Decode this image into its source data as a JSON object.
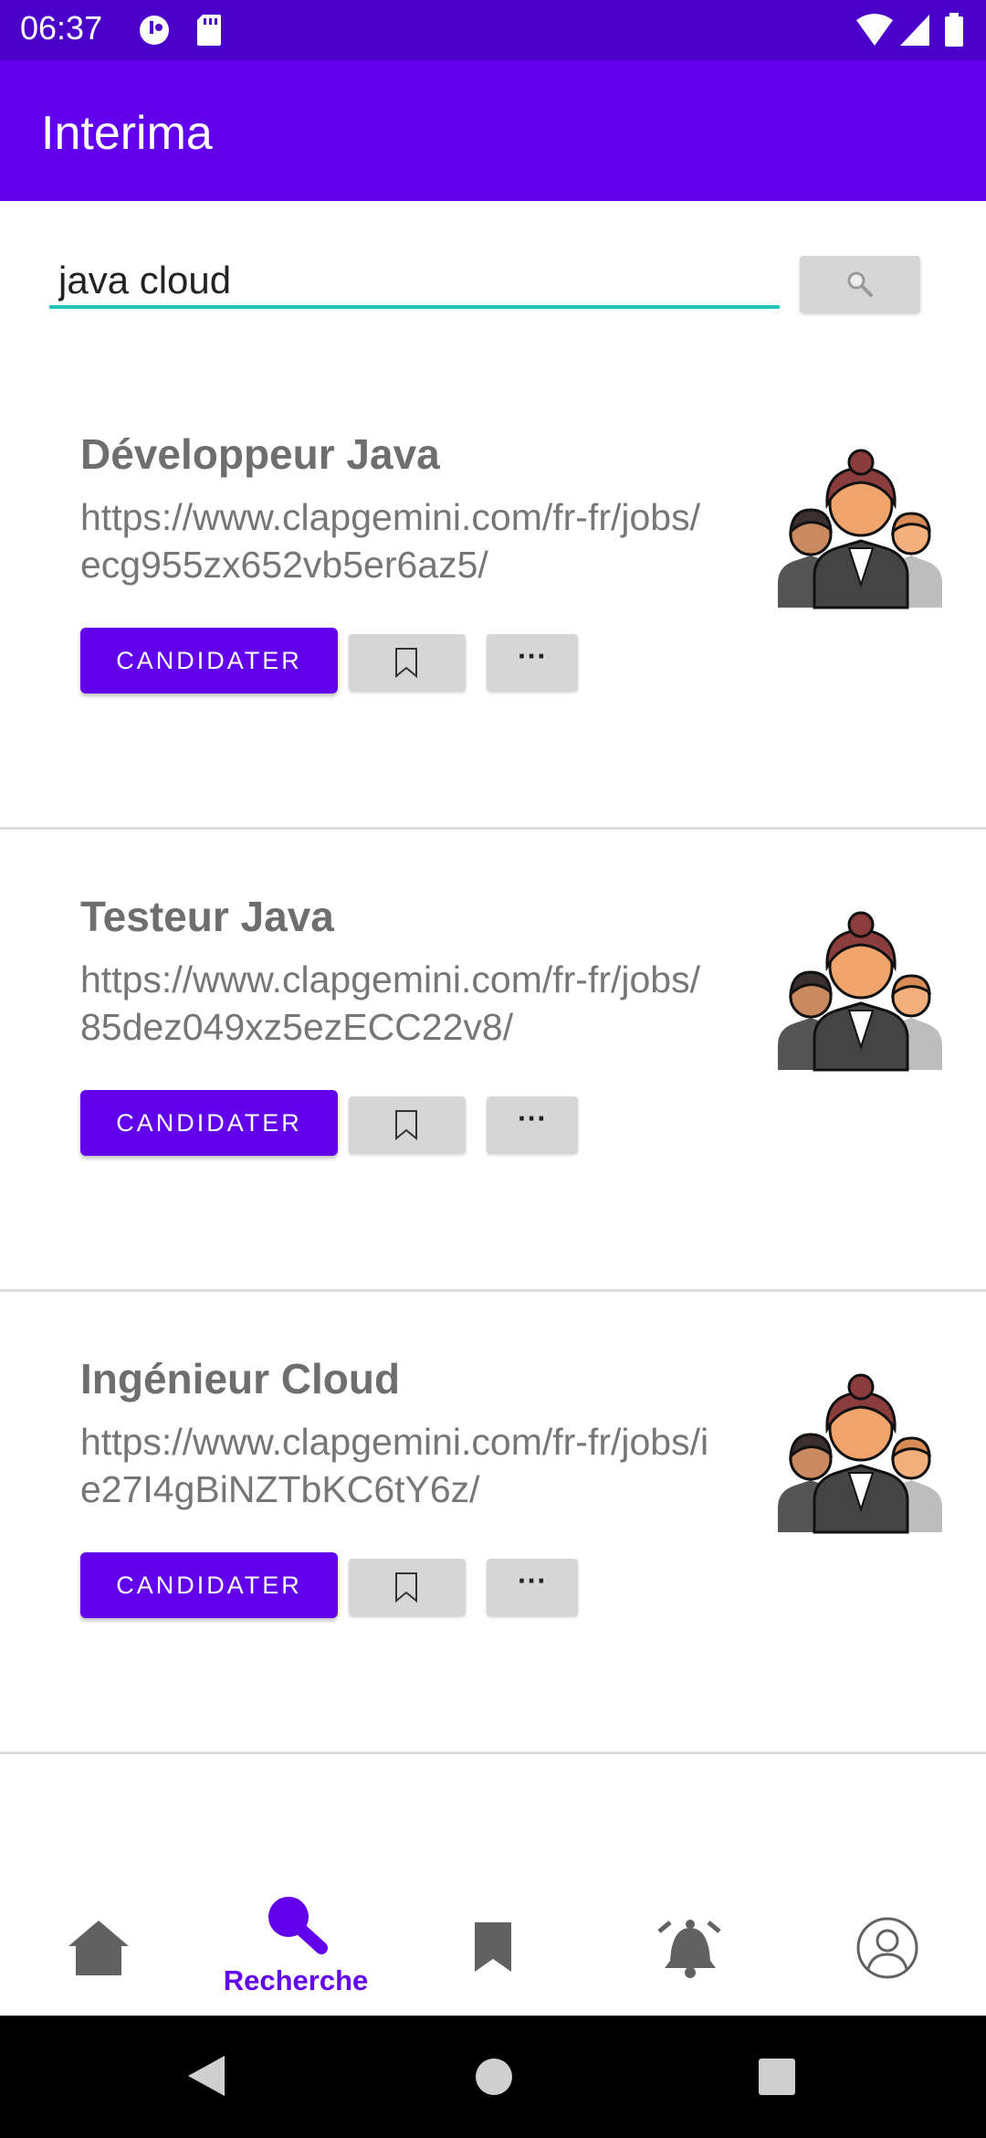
{
  "status_bar": {
    "time": "06:37"
  },
  "app_bar": {
    "title": "Interima"
  },
  "search": {
    "value": "java cloud"
  },
  "jobs": [
    {
      "title": "Développeur Java",
      "url": "https://www.clapgemini.com/fr-fr/jobs/ecg955zx652vb5er6az5/",
      "apply_label": "CANDIDATER",
      "more_label": "···"
    },
    {
      "title": "Testeur Java",
      "url": "https://www.clapgemini.com/fr-fr/jobs/85dez049xz5ezECC22v8/",
      "apply_label": "CANDIDATER",
      "more_label": "···"
    },
    {
      "title": "Ingénieur Cloud",
      "url": "https://www.clapgemini.com/fr-fr/jobs/ie27I4gBiNZTbKC6tY6z/",
      "apply_label": "CANDIDATER",
      "more_label": "···"
    }
  ],
  "bottom_nav": {
    "items": [
      {
        "icon": "home-icon",
        "label": ""
      },
      {
        "icon": "search-icon",
        "label": "Recherche",
        "active": true
      },
      {
        "icon": "bookmark-icon",
        "label": ""
      },
      {
        "icon": "bell-icon",
        "label": ""
      },
      {
        "icon": "profile-icon",
        "label": ""
      }
    ]
  },
  "colors": {
    "primary": "#6200ee",
    "status_bar": "#4a00c8",
    "accent": "#1fc7b7",
    "inactive_icon": "#616161"
  }
}
